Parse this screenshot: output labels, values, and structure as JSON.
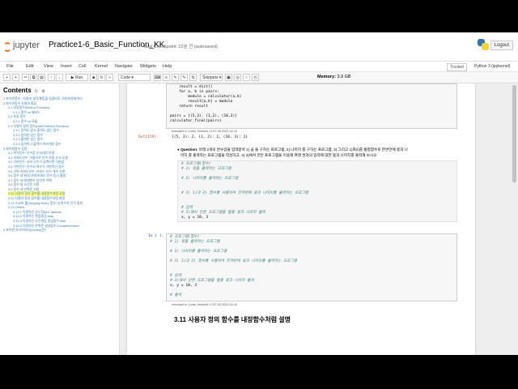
{
  "header": {
    "logo_text": "jupyter",
    "notebook_title": "Practice1-6_Basic_Function_KK",
    "checkpoint": "Last Checkpoint: 22분 전  (autosaved)",
    "logout_label": "Logout"
  },
  "menubar": {
    "items": [
      "File",
      "Edit",
      "View",
      "Insert",
      "Cell",
      "Kernel",
      "Navigate",
      "Widgets",
      "Help"
    ],
    "trusted": "Trusted",
    "kernel": "Python 3 (ipykernel)"
  },
  "toolbar": {
    "run_label": "Run",
    "cell_type": "Code",
    "snippets": "Snippets",
    "memory_label": "Memory:",
    "memory_value": "3.9 GB"
  },
  "toc": {
    "title": "Contents",
    "items": [
      "1  파이썬함수 : 사람의 생각/행동을 컴퓨터로 구현/자동화하다",
      "2  파이썬함수 유형과 종류",
      "2.1  내장함수(Built-in Function)",
      "2.1.1  함수 vs 메서드",
      "2.2  외장 함수",
      "2.2.1  함수 vs 모듈",
      "2.3  사용자 정의 함수(User Defined Function)",
      "2.3.1  입력도 없고 출력도 없는 함수",
      "2.3.2  입력만 있는 함수",
      "2.3.3  출력만 있는 함수",
      "2.3.4  입력이나 출력이 여러개인 함수",
      "3  파이썬함수 응용",
      "3.1  위치인수: 인수값 순서대로 반영",
      "3.2  키워드인수: 이름으로 인수 지정 순서 무관",
      "3.3  기본인수: 유저 인수가 공백이면 기본값",
      "3.4  가변인수: 인수의 개수가 가변적인 경우",
      "3.5  가변 키워드인수: 키워드 인수 개수 가변",
      "3.6  함수 내 위치/가변/키워드 인수 동시 활용",
      "3.7  함수 내 매개변수 선언의 이해",
      "3.8  함수 내 조건문 사용",
      "3.9  함수 내 반복문 사용",
      "3.10  사용자 정의 함수를 내장함수처럼 사용",
      "3.11  사용자 정의 함수를 내장함수처럼 설명",
      "3.12  스코프 룰(Scoping Rule): 함수 내 변수의 인식 범위",
      "3.13  Others",
      "3.13.1  익명적인 균드적/pre: lambda",
      "3.13.2  익명적인 편집중심:map",
      "3.13.3  익명적인 조건편집 중립함수:filter",
      "3.13.4  익명적인 반복문 생성함수:Comprehension",
      "4  파이썬 라이브러리(Library)란?"
    ],
    "highlighted_index": 21
  },
  "cells": {
    "cell1_code": [
      "    result = dict()",
      "    for a, b in pairs:",
      "        modulo = calculator(a,b)",
      "        result[a,b] = modulo",
      "    return result",
      "",
      "pairs = [(5,3), (1,2), (10,3)]",
      "calculator_final(pairs)"
    ],
    "cell1_exec": "executed in 14ms, finished 17:57:26 2022-04-10",
    "out_prompt": "Out[159]:",
    "out_text": "{(5, 3): 2, (1, 2): 1, (10, 3): 1}",
    "question_lines": [
      "Question: 아래 2개의 변수값을 입력받아 1) 곱 을 구하는 프로그램, 2) 나머지 를 구하는 프로그램, 3) 그리고 1)와2)를 통합함수로 한번만에 몫과 나",
      "머지 를 출력하는 프로그램을 작성하고, 4) 3)에서 만든 프로그램을 이용해 여래 쌍과의 입력에 대한 몫과 나머지를 출력해 보시오"
    ],
    "md_block": [
      "# 프로그램[함수]",
      "# 1) 몫을 출력하는 프로그램",
      "",
      "# 2) 나머지를 출력하는 프로그램",
      "",
      "",
      "# 3) 1)과 2) 함수를 사용하여 한꺼번에 몫과 나머지를 출력하는 프로그램",
      "",
      "",
      "# 입력",
      "# 3)에서 만든 프로그램을 활용 몫과 나머지 출력",
      "x, y = 10, 3"
    ],
    "in_prompt": "In [ ]:",
    "cell2_code": [
      "# 프로그램[함수]",
      "# 1) 몫을 출력하는 프로그램",
      "",
      "# 2) 나머지를 출력하는 프로그램",
      "",
      "# 3) 1)과 2) 함수를 사용하여 한꺼번에 몫과 나머지를 출력하는 프로그램",
      "",
      "",
      "# 입력",
      "# 3)에서 만든 프로그램을 활용 몫과 나머지 출력",
      "x, y = 10, 3",
      "",
      "# 출력"
    ],
    "cell2_exec": "executed in 14ms, finished 17:57:26 2022-04-10",
    "section_heading": "3.11  사용자 정의 함수를 내장함수처럼 설명"
  }
}
